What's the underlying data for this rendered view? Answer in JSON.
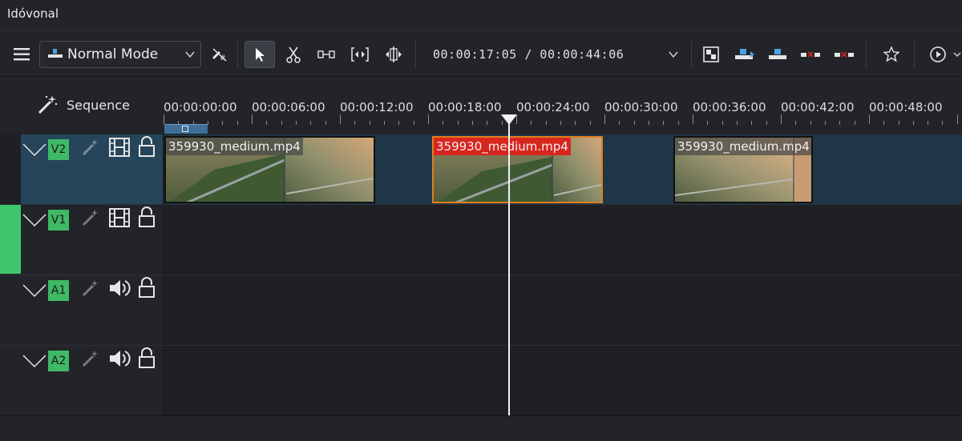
{
  "window": {
    "title": "Idóvonal"
  },
  "toolbar": {
    "mode_label": "Normal Mode",
    "timecode": "00:00:17:05 / 00:00:44:06"
  },
  "timeline": {
    "sequence_label": "Sequence",
    "ruler_labels": [
      "00:00:00:00",
      "00:00:06:00",
      "00:00:12:00",
      "00:00:18:00",
      "00:00:24:00",
      "00:00:30:00",
      "00:00:36:00",
      "00:00:42:00",
      "00:00:48:00"
    ],
    "tracks": [
      {
        "name": "V2",
        "type": "video"
      },
      {
        "name": "V1",
        "type": "video"
      },
      {
        "name": "A1",
        "type": "audio"
      },
      {
        "name": "A2",
        "type": "audio"
      }
    ],
    "clips": [
      {
        "label": "359930_medium.mp4",
        "selected": false
      },
      {
        "label": "359930_medium.mp4",
        "selected": true
      },
      {
        "label": "359930_medium.mp4",
        "selected": false
      }
    ]
  },
  "colors": {
    "track_badge": "#3fb966",
    "selection_border": "#e07f1e",
    "selected_label_bg": "#d7261e",
    "active_track_lane": "#1f3646"
  }
}
